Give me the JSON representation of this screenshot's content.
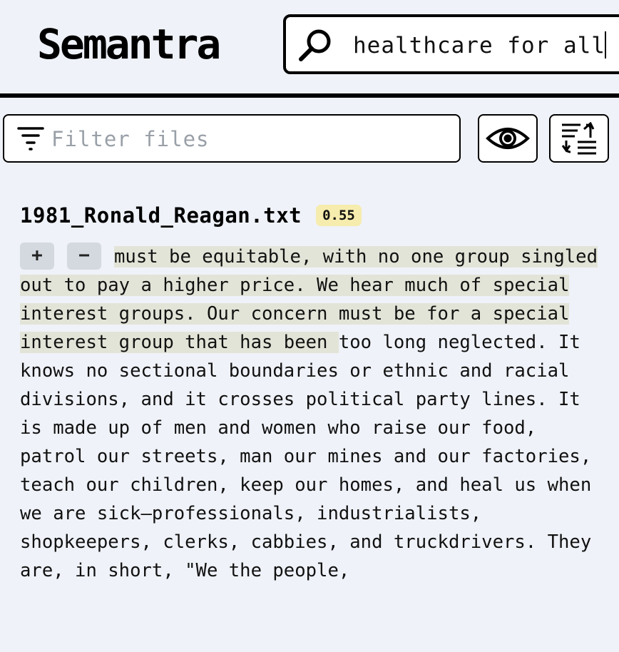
{
  "app": {
    "logo": "Semantra"
  },
  "search": {
    "query": "healthcare for all"
  },
  "filter": {
    "placeholder": "Filter files"
  },
  "toolbar": {
    "preview_icon": "eye-icon",
    "sort_icon": "sort-swap-icon"
  },
  "result": {
    "file_name": "1981_Ronald_Reagan.txt",
    "score": "0.55",
    "expand_label": "+",
    "collapse_label": "−",
    "highlighted_text": "must be equitable, with no one group singled out to pay a higher price. We hear much of special interest groups. Our concern must be for a special interest group that has been ",
    "rest_text": "too long neglected. It knows no sectional boundaries or ethnic and racial divisions, and it crosses political party lines. It is made up of men and women who raise our food, patrol our streets, man our mines and our factories, teach our children, keep our homes, and heal us when we are sick—professionals, industrialists, shopkeepers, clerks, cabbies, and truckdrivers. They are, in short, \"We the people,"
  },
  "colors": {
    "background": "#eff2f8",
    "highlight": "#e3e4d8",
    "score_badge": "#f6ecad",
    "button_gray": "#d4d9e0"
  }
}
